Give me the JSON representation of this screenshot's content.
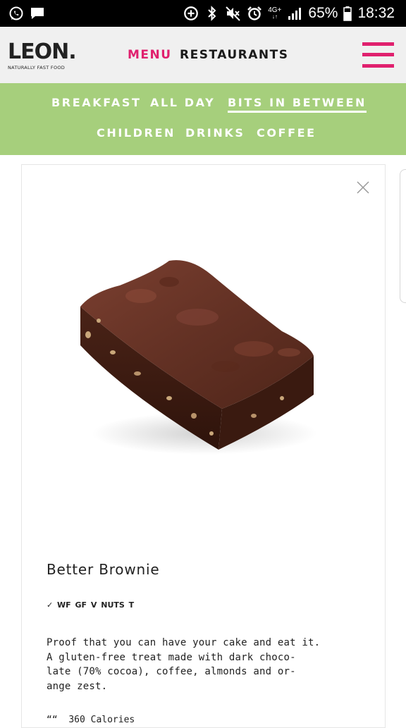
{
  "status_bar": {
    "network": "4G+",
    "battery": "65%",
    "time": "18:32"
  },
  "header": {
    "logo_main": "LEON.",
    "logo_tagline": "NATURALLY FAST FOOD",
    "nav": {
      "menu": "MENU",
      "restaurants": "RESTAURANTS"
    },
    "accent_color": "#e0206e"
  },
  "categories": {
    "background_color": "#a6cf7c",
    "items": [
      "BREAKFAST",
      "ALL DAY",
      "BITS IN BETWEEN",
      "CHILDREN",
      "DRINKS",
      "COFFEE"
    ],
    "active": "BITS IN BETWEEN"
  },
  "product": {
    "title": "Better Brownie",
    "dietary": "✓ WF GF V NUTS T",
    "description_lines": [
      "Proof that you can have your cake and eat it.",
      "A gluten-free treat made with dark choco-",
      "late (70% cocoa), coffee, almonds and or-",
      "ange zest."
    ],
    "calories": "360 Calories"
  },
  "icons": {
    "whatsapp": "whatsapp-icon",
    "message": "message-icon",
    "data_saver": "data-saver-icon",
    "bluetooth": "bluetooth-icon",
    "mute": "mute-icon",
    "alarm": "alarm-icon",
    "signal": "signal-icon",
    "battery": "battery-icon",
    "hamburger": "hamburger-menu-icon",
    "close": "close-icon",
    "brownie": "brownie-image"
  }
}
